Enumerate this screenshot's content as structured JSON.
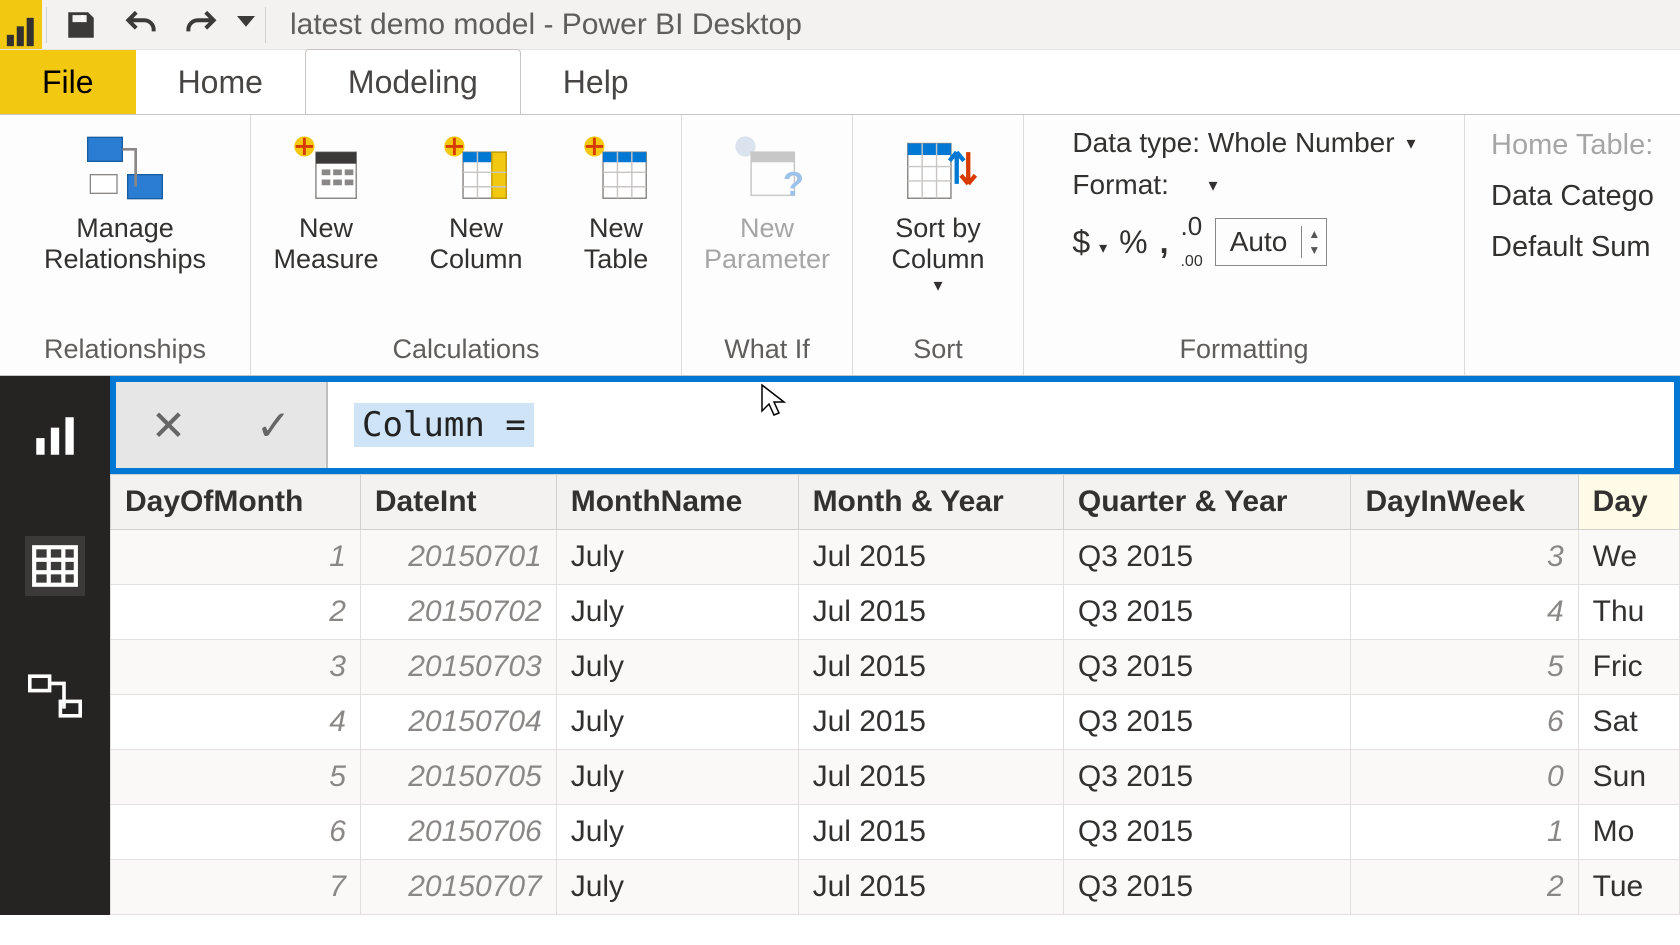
{
  "title": "latest demo model - Power BI Desktop",
  "tabs": {
    "file": "File",
    "home": "Home",
    "modeling": "Modeling",
    "help": "Help"
  },
  "ribbon": {
    "manage_rel": "Manage Relationships",
    "new_measure": "New Measure",
    "new_column": "New Column",
    "new_table": "New Table",
    "new_param": "New Parameter",
    "sort_by": "Sort by Column",
    "grp_rel": "Relationships",
    "grp_calc": "Calculations",
    "grp_whatif": "What If",
    "grp_sort": "Sort",
    "grp_fmt": "Formatting",
    "data_type": "Data type: Whole Number",
    "format": "Format:",
    "spin": "Auto",
    "home_table": "Home Table:",
    "data_cat": "Data Catego",
    "def_sum": "Default Sum"
  },
  "formula": "Column =",
  "columns": [
    "DayOfMonth",
    "DateInt",
    "MonthName",
    "Month & Year",
    "Quarter & Year",
    "DayInWeek",
    "Day"
  ],
  "rows": [
    {
      "dom": "1",
      "di": "20150701",
      "mn": "July",
      "my": "Jul 2015",
      "qy": "Q3 2015",
      "dw": "3",
      "dn": "We"
    },
    {
      "dom": "2",
      "di": "20150702",
      "mn": "July",
      "my": "Jul 2015",
      "qy": "Q3 2015",
      "dw": "4",
      "dn": "Thu"
    },
    {
      "dom": "3",
      "di": "20150703",
      "mn": "July",
      "my": "Jul 2015",
      "qy": "Q3 2015",
      "dw": "5",
      "dn": "Fric"
    },
    {
      "dom": "4",
      "di": "20150704",
      "mn": "July",
      "my": "Jul 2015",
      "qy": "Q3 2015",
      "dw": "6",
      "dn": "Sat"
    },
    {
      "dom": "5",
      "di": "20150705",
      "mn": "July",
      "my": "Jul 2015",
      "qy": "Q3 2015",
      "dw": "0",
      "dn": "Sun"
    },
    {
      "dom": "6",
      "di": "20150706",
      "mn": "July",
      "my": "Jul 2015",
      "qy": "Q3 2015",
      "dw": "1",
      "dn": "Mo"
    },
    {
      "dom": "7",
      "di": "20150707",
      "mn": "July",
      "my": "Jul 2015",
      "qy": "Q3 2015",
      "dw": "2",
      "dn": "Tue"
    }
  ]
}
